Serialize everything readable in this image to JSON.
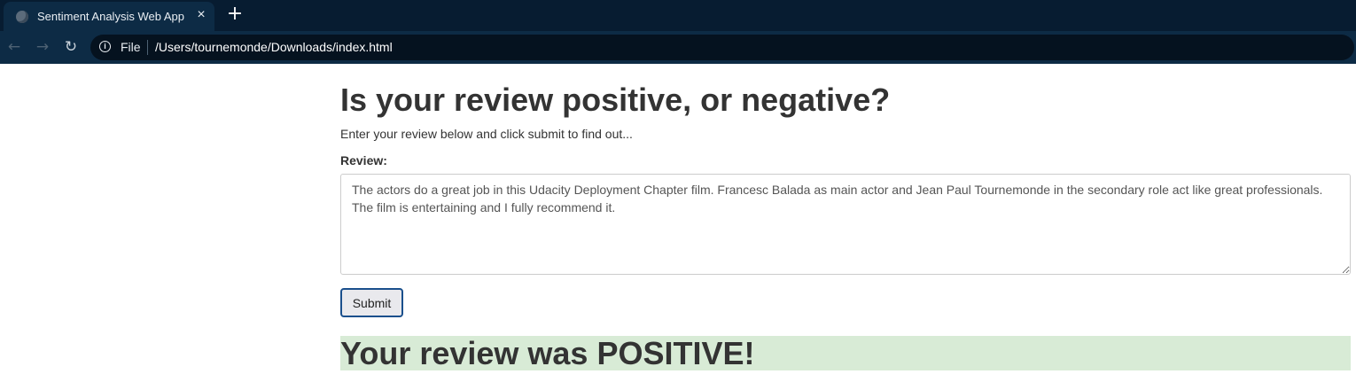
{
  "browser": {
    "tab": {
      "title": "Sentiment Analysis Web App",
      "close_icon": "×"
    },
    "new_tab_icon": "+",
    "toolbar": {
      "back_icon": "←",
      "forward_icon": "→",
      "reload_icon": "↻",
      "info_icon": "i",
      "scheme_label": "File",
      "url": "/Users/tournemonde/Downloads/index.html"
    }
  },
  "page": {
    "heading": "Is your review positive, or negative?",
    "intro": "Enter your review below and click submit to find out...",
    "form": {
      "review_label": "Review:",
      "review_value": "The actors do a great job in this Udacity Deployment Chapter film. Francesc Balada as main actor and Jean Paul Tournemonde in the secondary role act like great professionals. The film is entertaining and I fully recommend it.",
      "submit_label": "Submit"
    },
    "result": {
      "text": "Your review was POSITIVE!",
      "color": "#d8ebd6"
    }
  }
}
